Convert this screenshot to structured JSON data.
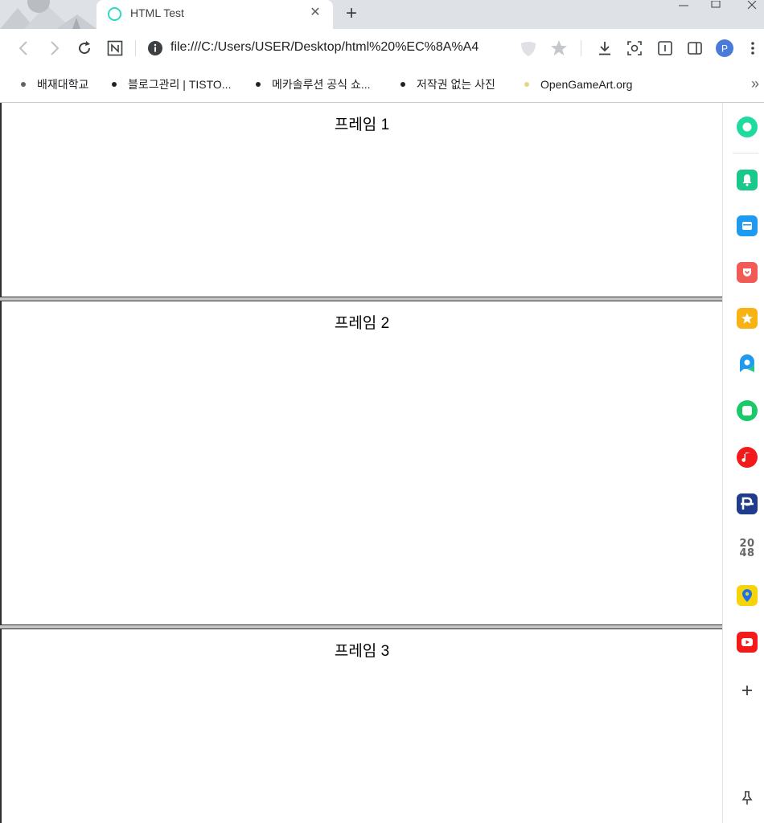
{
  "tab": {
    "title": "HTML Test",
    "close": "✕",
    "new_tab": "+"
  },
  "toolbar": {
    "url": "file:///C:/Users/USER/Desktop/html%20%EC%8A%A4"
  },
  "bookmarks": [
    {
      "label": "배재대학교",
      "dot": "#5f6368"
    },
    {
      "label": "블로그관리 | TISTO...",
      "dot": "#111111"
    },
    {
      "label": "메카솔루션 공식 쇼...",
      "dot": "#111111"
    },
    {
      "label": "저작권 없는 사진",
      "dot": "#111111"
    },
    {
      "label": "OpenGameArt.org",
      "dot": "#e8d48a"
    }
  ],
  "bookmarks_more": "»",
  "frames": [
    {
      "title": "프레임 1"
    },
    {
      "title": "프레임 2"
    },
    {
      "title": "프레임 3"
    }
  ],
  "side_panel": {
    "game_2048_text": "20\n48"
  },
  "colors": {
    "tab_strip": "#dee1e6",
    "profile": "#4a7bd8",
    "frame_border": "#c6c6c6"
  }
}
